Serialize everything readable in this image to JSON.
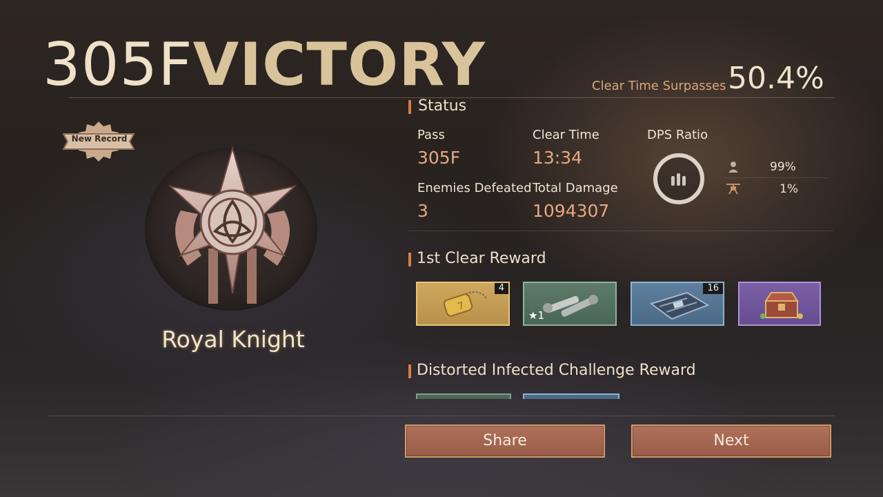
{
  "header": {
    "floor": "305F",
    "result": "VICTORY",
    "surpass_label": "Clear Time Surpasses",
    "surpass_value": "50.4%"
  },
  "emblem": {
    "badge_label": "New Record",
    "rank_name": "Royal Knight"
  },
  "status": {
    "section_title": "Status",
    "pass_label": "Pass",
    "pass_value": "305F",
    "clear_time_label": "Clear Time",
    "clear_time_value": "13:34",
    "enemies_label": "Enemies Defeated",
    "enemies_value": "3",
    "damage_label": "Total Damage",
    "damage_value": "1094307",
    "dps_label": "DPS Ratio",
    "dps_rows": [
      {
        "icon": "soldier-icon",
        "value": "99%"
      },
      {
        "icon": "drone-icon",
        "value": "1%"
      }
    ]
  },
  "first_clear": {
    "section_title": "1st Clear Reward",
    "items": [
      {
        "icon": "dog-tag-icon",
        "rarity": "gold",
        "qty": "4"
      },
      {
        "icon": "gear-parts-icon",
        "rarity": "green",
        "star_qty": "1"
      },
      {
        "icon": "circuit-board-icon",
        "rarity": "blue",
        "qty": "16"
      },
      {
        "icon": "treasure-chest-icon",
        "rarity": "purple"
      }
    ]
  },
  "challenge": {
    "section_title": "Distorted Infected Challenge Reward"
  },
  "buttons": {
    "share": "Share",
    "next": "Next"
  },
  "colors": {
    "accent": "#e07a43",
    "button": "#a86650",
    "value_text": "#e8a781",
    "gold_rarity": "#e8c57b",
    "green_rarity": "#8fb59b",
    "blue_rarity": "#8fb2d2",
    "purple_rarity": "#b093d8"
  }
}
